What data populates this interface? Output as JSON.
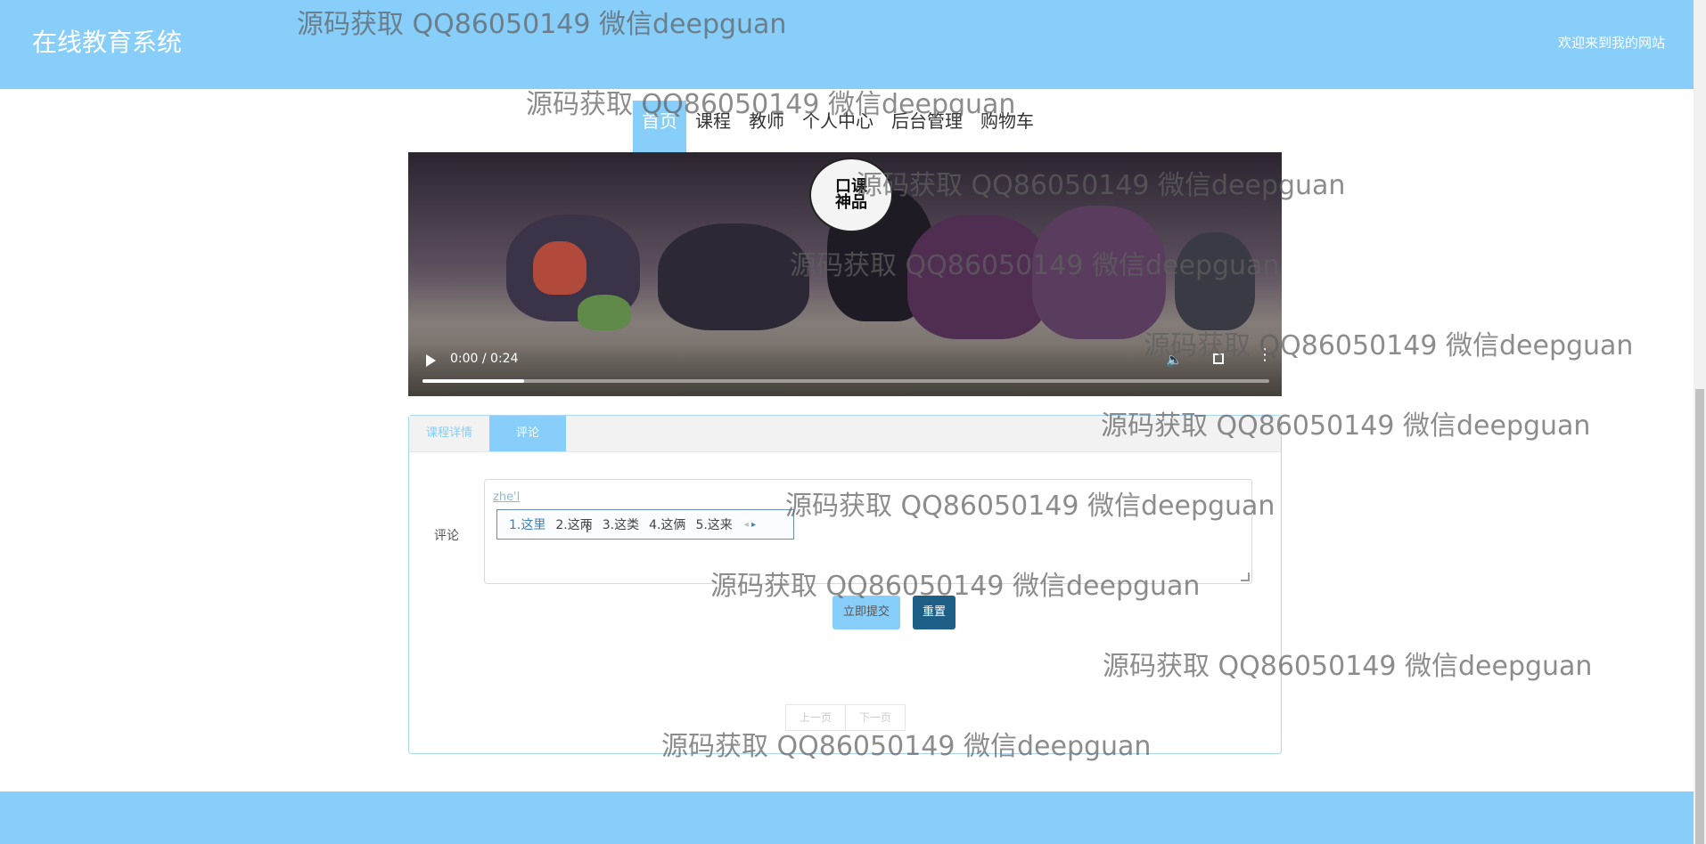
{
  "header": {
    "site_title": "在线教育系统",
    "welcome": "欢迎来到我的网站"
  },
  "nav": {
    "items": [
      {
        "label": "首页",
        "active": true
      },
      {
        "label": "课程",
        "active": false
      },
      {
        "label": "教师",
        "active": false
      },
      {
        "label": "个人中心",
        "active": false
      },
      {
        "label": "后台管理",
        "active": false
      },
      {
        "label": "购物车",
        "active": false
      }
    ]
  },
  "video": {
    "time": "0:00 / 0:24",
    "progress": 0.12,
    "logo_text": "口课\n神品"
  },
  "tabs": [
    {
      "label": "课程详情",
      "active": false
    },
    {
      "label": "评论",
      "active": true
    }
  ],
  "comment": {
    "label": "评论",
    "input_value": "zhe'l",
    "ime_candidates": [
      "1.这里",
      "2.这两",
      "3.这类",
      "4.这俩",
      "5.这来"
    ],
    "submit": "立即提交",
    "reset": "重置"
  },
  "pager": {
    "prev": "上一页",
    "next": "下一页"
  },
  "watermark": "源码获取 QQ86050149 微信deepguan",
  "colors": {
    "primary": "#87cefa",
    "dark_button": "#1e5f87"
  }
}
